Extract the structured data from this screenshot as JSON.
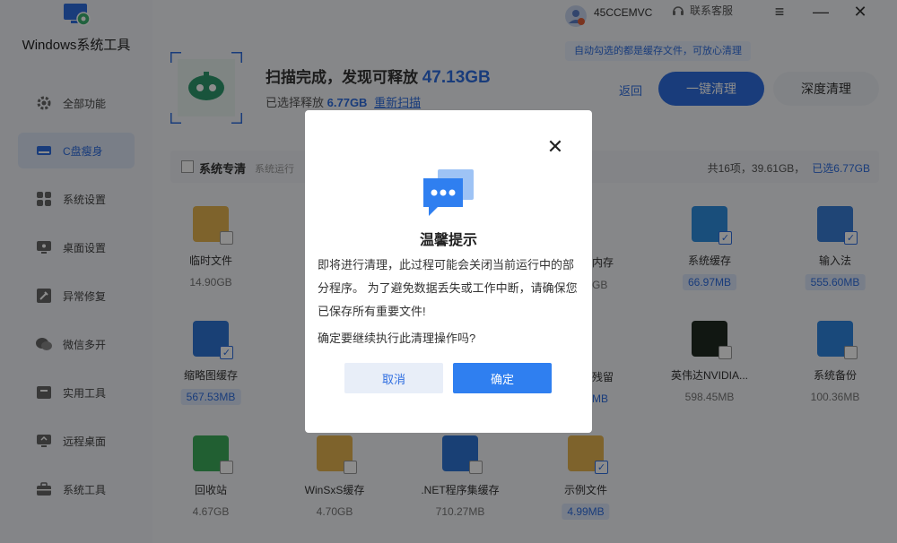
{
  "app": {
    "title": "Windows系统工具"
  },
  "sidebar": {
    "items": [
      {
        "label": "全部功能",
        "icon": "gear-icon"
      },
      {
        "label": "C盘瘦身",
        "icon": "drive-icon"
      },
      {
        "label": "系统设置",
        "icon": "grid-icon"
      },
      {
        "label": "桌面设置",
        "icon": "monitor-icon"
      },
      {
        "label": "异常修复",
        "icon": "repair-icon"
      },
      {
        "label": "微信多开",
        "icon": "chat-icon"
      },
      {
        "label": "实用工具",
        "icon": "toolbox-icon"
      },
      {
        "label": "远程桌面",
        "icon": "remote-icon"
      },
      {
        "label": "系统工具",
        "icon": "briefcase-icon"
      }
    ]
  },
  "topbar": {
    "user_id": "45CCEMVC",
    "service_label": "联系客服"
  },
  "header": {
    "title_prefix": "扫描完成，发现可释放",
    "title_amount": "47.13GB",
    "sub_prefix": "已选择释放",
    "sub_amount": "6.77GB",
    "rescan": "重新扫描",
    "tooltip": "自动勾选的都是缓存文件，可放心清理",
    "back": "返回",
    "one_click": "一键清理",
    "deep_clean": "深度清理"
  },
  "section": {
    "title": "系统专清",
    "hint": "系统运行",
    "summary": "共16项，39.61GB，",
    "selected": "已选6.77GB"
  },
  "items": [
    {
      "name": "临时文件",
      "size": "14.90GB",
      "checked": false,
      "color": "#e6b450"
    },
    {
      "name": "系统缓存",
      "size": "66.97MB",
      "checked": true,
      "color": "#2e8ee0"
    },
    {
      "name": "输入法",
      "size": "555.60MB",
      "checked": true,
      "color": "#3a7fd8"
    },
    {
      "name": "缩略图缓存",
      "size": "567.53MB",
      "checked": true,
      "color": "#2e76d6"
    },
    {
      "name": "英伟达NVIDIA...",
      "size": "598.45MB",
      "checked": false,
      "color": "#1f2a22"
    },
    {
      "name": "系统备份",
      "size": "100.36MB",
      "checked": false,
      "color": "#2e86e0"
    },
    {
      "name": "回收站",
      "size": "4.67GB",
      "checked": false,
      "color": "#3cae5c"
    },
    {
      "name": "WinSxS缓存",
      "size": "4.70GB",
      "checked": false,
      "color": "#e6b450"
    },
    {
      "name": ".NET程序集缓存",
      "size": "710.27MB",
      "checked": false,
      "color": "#2e76d6"
    },
    {
      "name": "示例文件",
      "size": "4.99MB",
      "checked": true,
      "color": "#e6b450"
    }
  ],
  "partial": {
    "label_frag1": "内存",
    "size_frag1": "GB",
    "label_frag2": "残留",
    "size_frag2": "MB"
  },
  "dialog": {
    "title": "温馨提示",
    "body": "即将进行清理，此过程可能会关闭当前运行中的部分程序。 为了避免数据丢失或工作中断，请确保您已保存所有重要文件!",
    "question": "确定要继续执行此清理操作吗?",
    "cancel": "取消",
    "confirm": "确定"
  },
  "colors": {
    "accent": "#2f6ee0",
    "confirm": "#2f7ff0"
  }
}
